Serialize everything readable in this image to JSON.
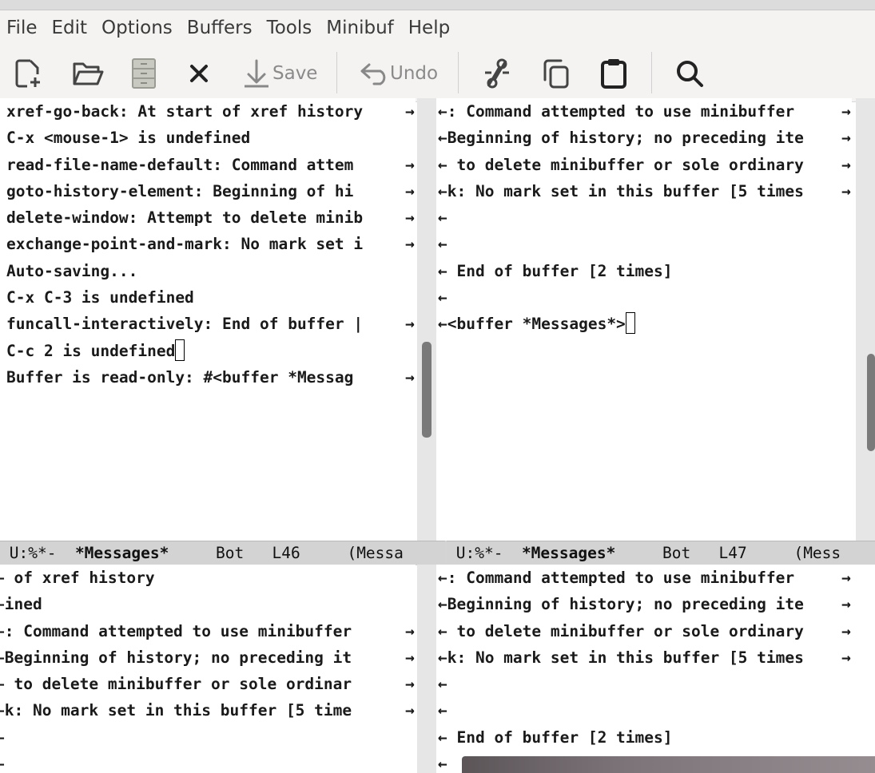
{
  "menu": [
    "File",
    "Edit",
    "Options",
    "Buffers",
    "Tools",
    "Minibuf",
    "Help"
  ],
  "toolbar": {
    "new_icon": "new-file-icon",
    "open_icon": "open-folder-icon",
    "dired_icon": "file-cabinet-icon",
    "close_icon": "close-icon",
    "save_label": "Save",
    "undo_label": "Undo",
    "cut_icon": "scissors-icon",
    "copy_icon": "copy-icon",
    "paste_icon": "clipboard-icon",
    "search_icon": "search-icon"
  },
  "windows": {
    "top_left": {
      "lines": [
        "xref-go-back: At start of xref history",
        "C-x <mouse-1> is undefined",
        "read-file-name-default: Command attem",
        "goto-history-element: Beginning of hi",
        "delete-window: Attempt to delete minib",
        "exchange-point-and-mark: No mark set i",
        "Auto-saving...",
        "C-x C-3 is undefined",
        "funcall-interactively: End of buffer |",
        "C-c 2 is undefined",
        "Buffer is read-only: #<buffer *Messag"
      ],
      "modeline": {
        "status": "U:%*-",
        "buffer": "*Messages*",
        "position": "Bot",
        "line": "L46",
        "mode": "(Messa"
      }
    },
    "top_right": {
      "lines": [
        "←: Command attempted to use minibuffer ",
        "←Beginning of history; no preceding ite",
        "← to delete minibuffer or sole ordinary",
        "←k: No mark set in this buffer [5 times",
        "←",
        "←",
        "← End of buffer [2 times]",
        "←",
        "←<buffer *Messages*>"
      ],
      "modeline": {
        "status": "U:%*-",
        "buffer": "*Messages*",
        "position": "Bot",
        "line": "L47",
        "mode": "(Mess"
      }
    },
    "bottom_left": {
      "lines": [
        "← of xref history",
        "←ined",
        "←: Command attempted to use minibuffer ",
        "←Beginning of history; no preceding it",
        "← to delete minibuffer or sole ordinar",
        "←k: No mark set in this buffer [5 time",
        "←",
        "←"
      ]
    },
    "bottom_right": {
      "lines": [
        "←: Command attempted to use minibuffer ",
        "←Beginning of history; no preceding ite",
        "← to delete minibuffer or sole ordinary",
        "←k: No mark set in this buffer [5 times",
        "←",
        "←",
        "← End of buffer [2 times]",
        "←"
      ]
    }
  },
  "truncation_glyph": "→"
}
